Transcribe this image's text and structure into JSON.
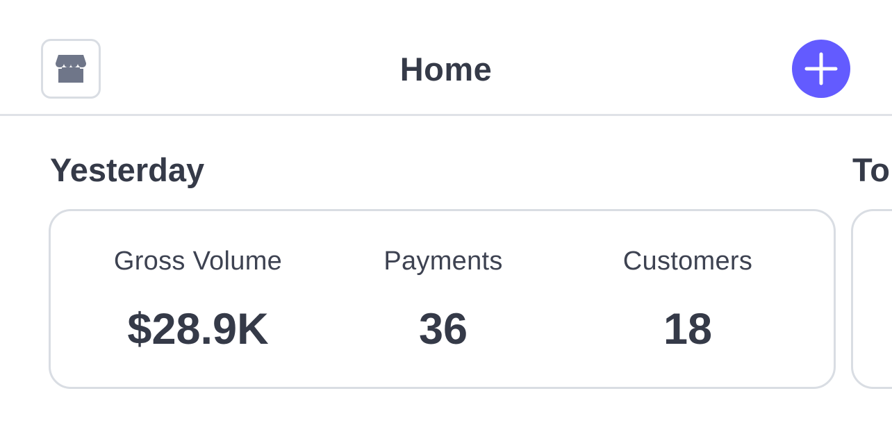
{
  "header": {
    "title": "Home",
    "store_icon": "store-icon",
    "add_icon": "plus-icon",
    "accent_color": "#635bff"
  },
  "sections": [
    {
      "title": "Yesterday",
      "metrics": [
        {
          "label": "Gross Volume",
          "value": "$28.9K"
        },
        {
          "label": "Payments",
          "value": "36"
        },
        {
          "label": "Customers",
          "value": "18"
        }
      ]
    },
    {
      "title": "To"
    }
  ]
}
